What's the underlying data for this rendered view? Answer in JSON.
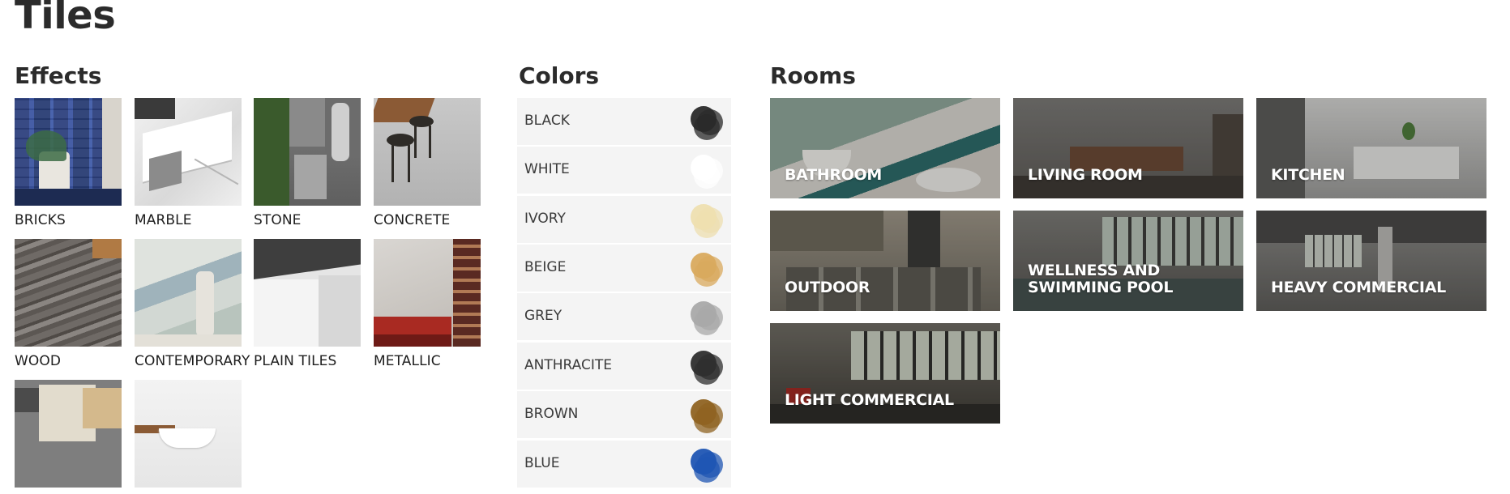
{
  "page": {
    "title": "Tiles"
  },
  "effects": {
    "title": "Effects",
    "items": [
      {
        "label": "BRICKS"
      },
      {
        "label": "MARBLE"
      },
      {
        "label": "STONE"
      },
      {
        "label": "CONCRETE"
      },
      {
        "label": "WOOD"
      },
      {
        "label": "CONTEMPORARY"
      },
      {
        "label": "PLAIN TILES"
      },
      {
        "label": "METALLIC"
      },
      {
        "label": ""
      },
      {
        "label": ""
      }
    ]
  },
  "colors": {
    "title": "Colors",
    "items": [
      {
        "label": "BLACK",
        "swatch": "#2a2a2a"
      },
      {
        "label": "WHITE",
        "swatch": "#ffffff"
      },
      {
        "label": "IVORY",
        "swatch": "#eedfb0"
      },
      {
        "label": "BEIGE",
        "swatch": "#d9aa5e"
      },
      {
        "label": "GREY",
        "swatch": "#a9a9a9"
      },
      {
        "label": "ANTHRACITE",
        "swatch": "#2e2e2e"
      },
      {
        "label": "BROWN",
        "swatch": "#8f6322"
      },
      {
        "label": "BLUE",
        "swatch": "#1f55b3"
      }
    ]
  },
  "rooms": {
    "title": "Rooms",
    "items": [
      {
        "label": "BATHROOM"
      },
      {
        "label": "LIVING ROOM"
      },
      {
        "label": "KITCHEN"
      },
      {
        "label": "OUTDOOR"
      },
      {
        "label": "WELLNESS AND SWIMMING POOL"
      },
      {
        "label": "HEAVY COMMERCIAL"
      },
      {
        "label": "LIGHT COMMERCIAL"
      }
    ]
  }
}
